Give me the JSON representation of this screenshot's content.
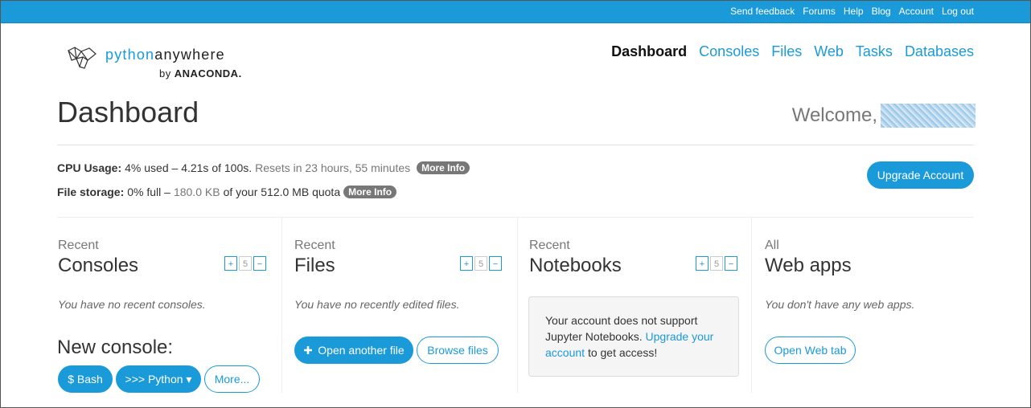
{
  "topbar": {
    "links": [
      "Send feedback",
      "Forums",
      "Help",
      "Blog",
      "Account",
      "Log out"
    ]
  },
  "logo": {
    "name_part1": "python",
    "name_part2": "anywhere",
    "by": "by",
    "brand": "ANACONDA."
  },
  "nav": {
    "items": [
      "Dashboard",
      "Consoles",
      "Files",
      "Web",
      "Tasks",
      "Databases"
    ],
    "active": "Dashboard"
  },
  "page": {
    "title": "Dashboard",
    "welcome": "Welcome,"
  },
  "usage": {
    "cpu_label": "CPU Usage:",
    "cpu_value": "4% used – 4.21s of 100s.",
    "cpu_reset": "Resets in 23 hours, 55 minutes",
    "storage_label": "File storage:",
    "storage_pct": "0% full –",
    "storage_used": "180.0 KB",
    "storage_of": "of your 512.0 MB quota",
    "more_info": "More Info",
    "upgrade_button": "Upgrade Account"
  },
  "consoles": {
    "small": "Recent",
    "big": "Consoles",
    "pager": {
      "plus": "+",
      "count": "5",
      "minus": "−"
    },
    "empty": "You have no recent consoles.",
    "new_console": "New console:",
    "bash": "$ Bash",
    "python": ">>> Python ▾",
    "more": "More..."
  },
  "files": {
    "small": "Recent",
    "big": "Files",
    "pager": {
      "plus": "+",
      "count": "5",
      "minus": "−"
    },
    "empty": "You have no recently edited files.",
    "open_file": "Open another file",
    "browse": "Browse files"
  },
  "notebooks": {
    "small": "Recent",
    "big": "Notebooks",
    "pager": {
      "plus": "+",
      "count": "5",
      "minus": "−"
    },
    "msg_before": "Your account does not support Jupyter Notebooks.",
    "msg_link": "Upgrade your account",
    "msg_after": "to get access!"
  },
  "webapps": {
    "small": "All",
    "big": "Web apps",
    "empty": "You don't have any web apps.",
    "open_tab": "Open Web tab"
  },
  "colors": {
    "accent": "#1a9ad9",
    "badge": "#777777"
  }
}
